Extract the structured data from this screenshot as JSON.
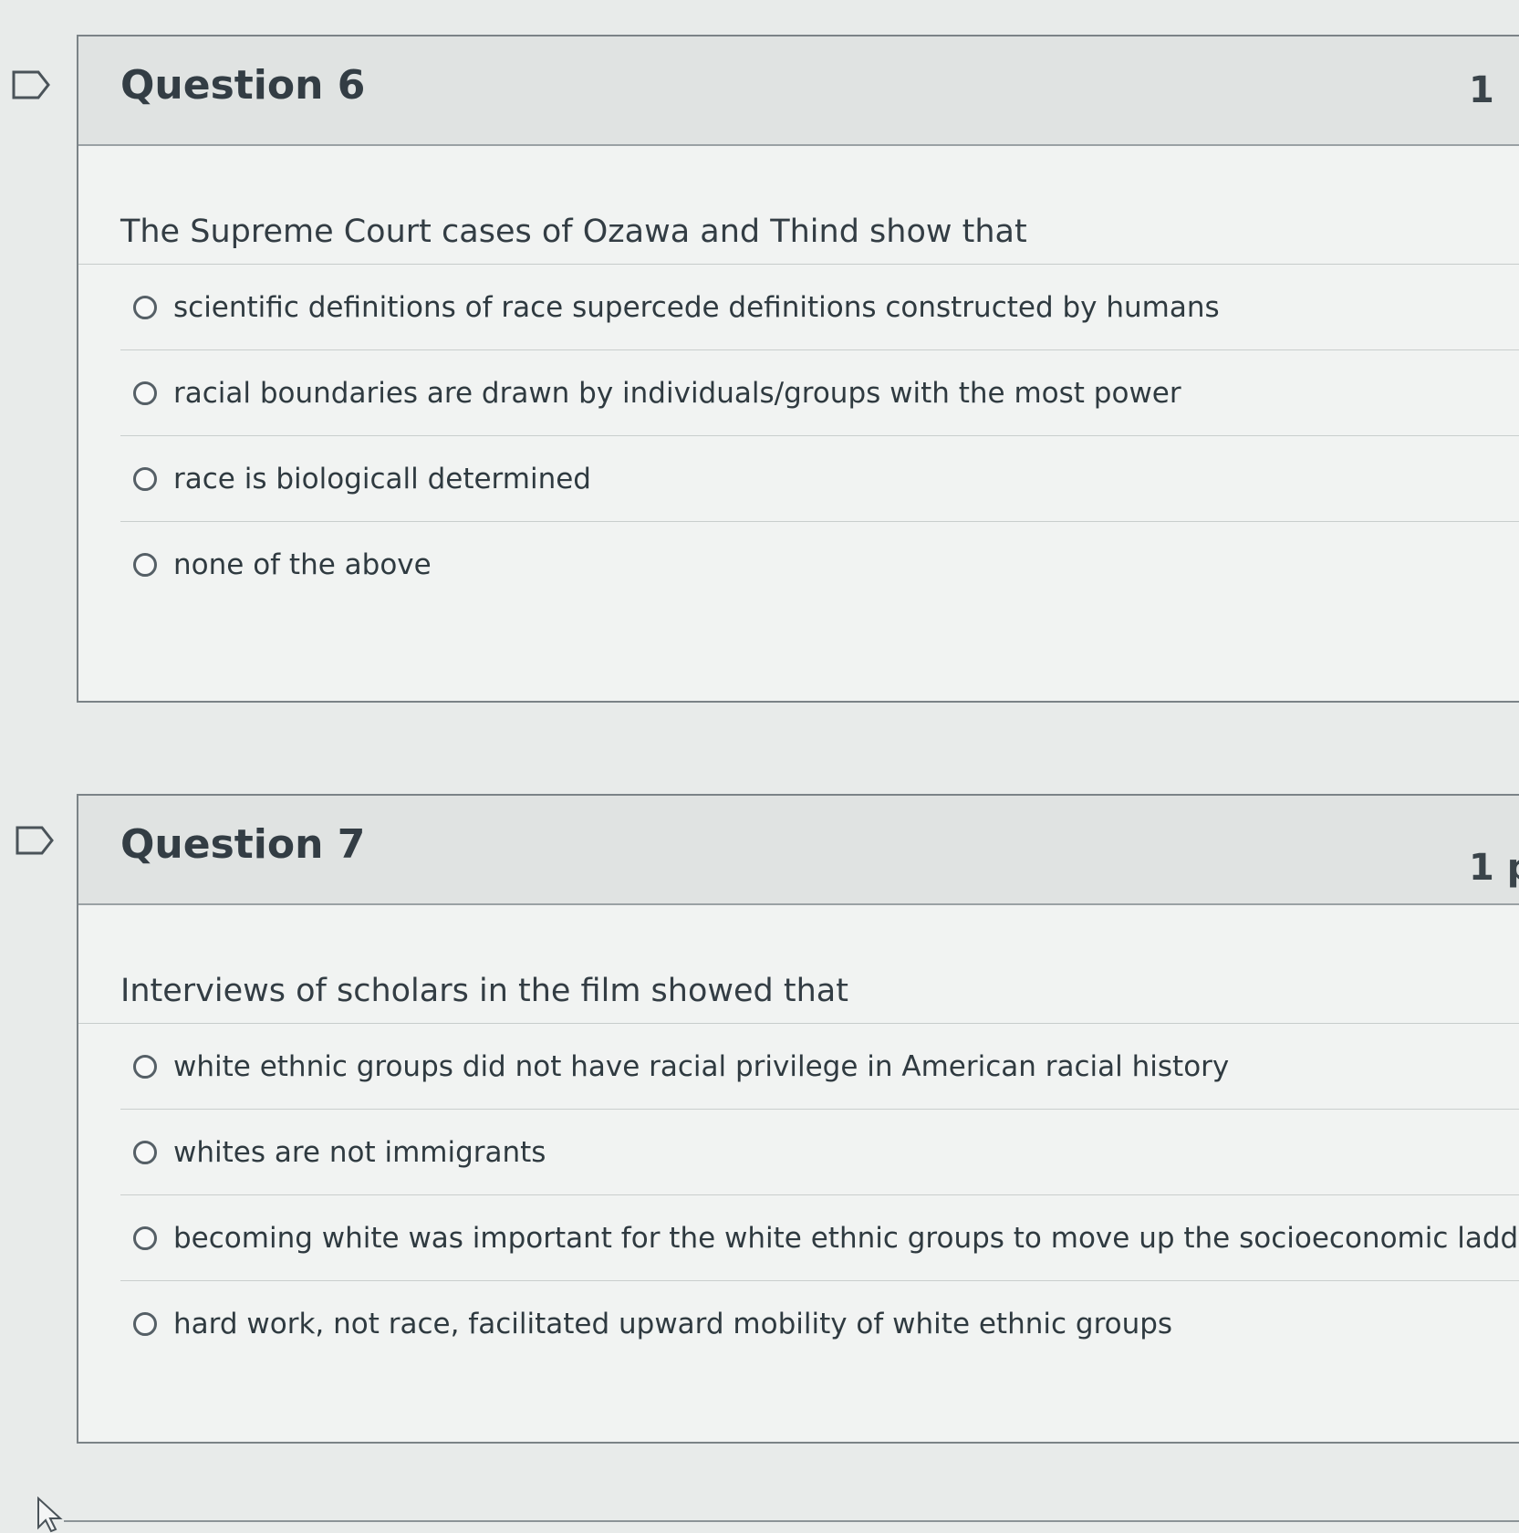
{
  "questions": [
    {
      "title": "Question 6",
      "points": "1",
      "text": "The Supreme Court cases of Ozawa and Thind show that",
      "answers": [
        "scientific definitions of race supercede definitions constructed by humans",
        "racial boundaries are drawn by individuals/groups with the most power",
        "race is biologicall determined",
        "none of the above"
      ]
    },
    {
      "title": "Question 7",
      "points": "1 p",
      "text": "Interviews of scholars in the film showed that",
      "answers": [
        "white ethnic groups did not have racial privilege in American racial history",
        "whites are not immigrants",
        "becoming white was important for the white ethnic groups to move up the socioeconomic ladder",
        "hard work, not race, facilitated upward mobility of white ethnic groups"
      ]
    }
  ]
}
